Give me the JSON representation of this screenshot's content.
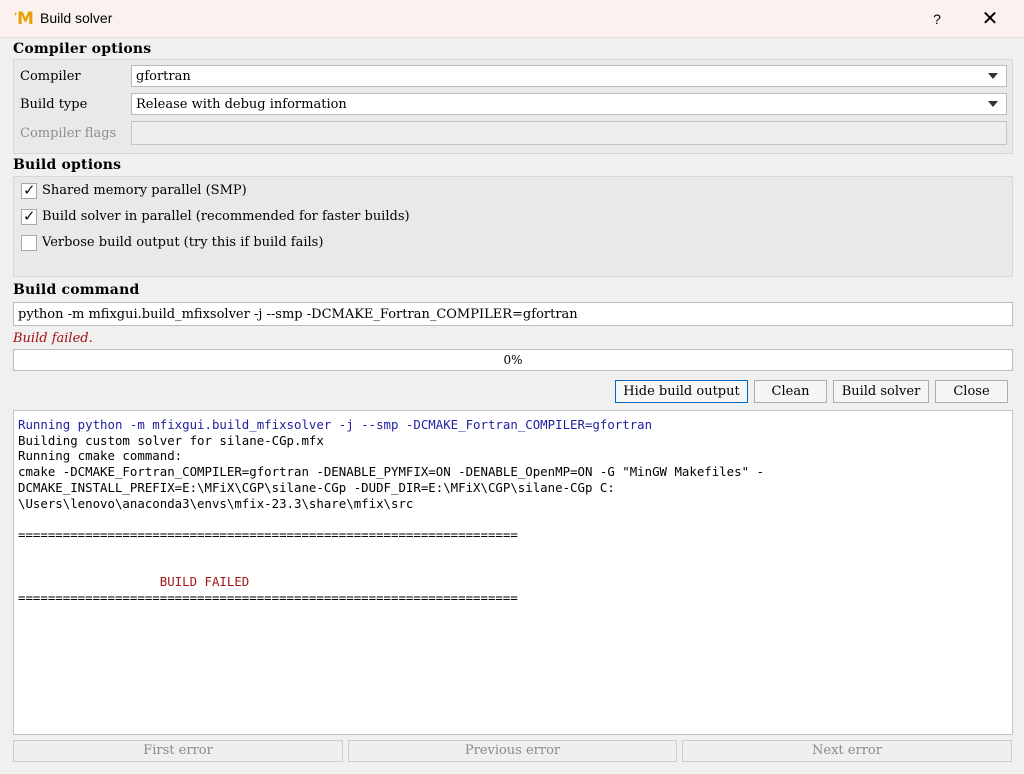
{
  "window": {
    "title": "Build solver",
    "app_icon": "mfix-logo-icon",
    "help_label": "?",
    "close_label": "✕"
  },
  "compiler_options": {
    "section_title": "Compiler options",
    "compiler_label": "Compiler",
    "compiler_value": "gfortran",
    "build_type_label": "Build type",
    "build_type_value": "Release with debug information",
    "flags_label": "Compiler flags",
    "flags_value": ""
  },
  "build_options": {
    "section_title": "Build options",
    "options": [
      {
        "label": "Shared memory parallel (SMP)",
        "checked": true
      },
      {
        "label": "Build solver in parallel (recommended for faster builds)",
        "checked": true
      },
      {
        "label": "Verbose build output (try this if build fails)",
        "checked": false
      }
    ]
  },
  "build_command": {
    "section_title": "Build command",
    "command": "python -m mfixgui.build_mfixsolver -j --smp -DCMAKE_Fortran_COMPILER=gfortran"
  },
  "status": {
    "message": "Build failed.",
    "progress_percent": 0,
    "progress_text": "0%"
  },
  "actions": {
    "hide_output_label": "Hide build output",
    "clean_label": "Clean",
    "build_label": "Build solver",
    "close_label": "Close"
  },
  "output": {
    "lines": [
      {
        "text": "Running python -m mfixgui.build_mfixsolver -j --smp -DCMAKE_Fortran_COMPILER=gfortran",
        "style": "blue"
      },
      {
        "text": "Building custom solver for silane-CGp.mfx",
        "style": ""
      },
      {
        "text": "Running cmake command:",
        "style": ""
      },
      {
        "text": "cmake -DCMAKE_Fortran_COMPILER=gfortran -DENABLE_PYMFIX=ON -DENABLE_OpenMP=ON -G \"MinGW Makefiles\" -",
        "style": ""
      },
      {
        "text": "DCMAKE_INSTALL_PREFIX=E:\\MFiX\\CGP\\silane-CGp -DUDF_DIR=E:\\MFiX\\CGP\\silane-CGp C:",
        "style": ""
      },
      {
        "text": "\\Users\\lenovo\\anaconda3\\envs\\mfix-23.3\\share\\mfix\\src",
        "style": ""
      },
      {
        "text": "",
        "style": ""
      },
      {
        "text": "===================================================================",
        "style": ""
      },
      {
        "text": "",
        "style": ""
      },
      {
        "text": "",
        "style": ""
      },
      {
        "text": "                   BUILD FAILED",
        "style": "red"
      },
      {
        "text": "===================================================================",
        "style": ""
      }
    ]
  },
  "navigation": {
    "first_error_label": "First error",
    "previous_error_label": "Previous error",
    "next_error_label": "Next error"
  },
  "colors": {
    "output_command": "#1f1fa0",
    "output_error": "#a01818",
    "status_error": "#a01010"
  }
}
